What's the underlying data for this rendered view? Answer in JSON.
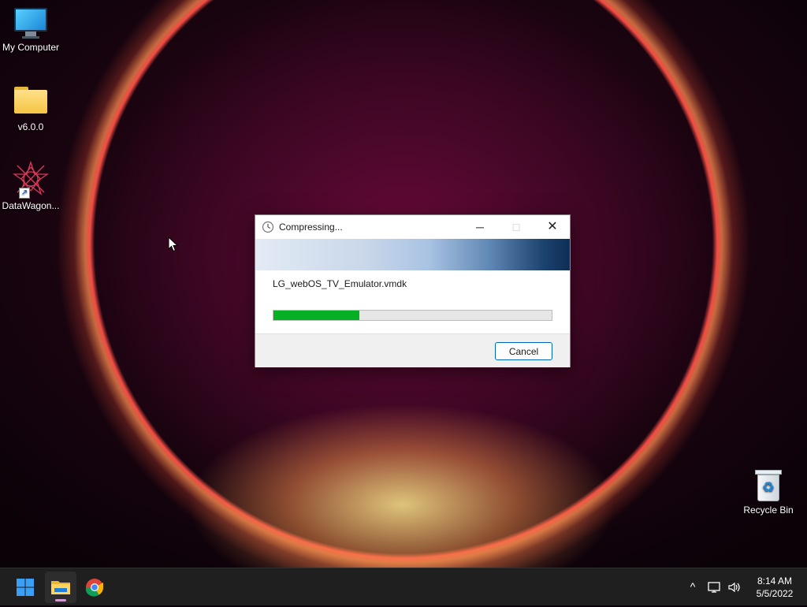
{
  "desktop": {
    "icons": [
      {
        "label": "My Computer",
        "icon": "monitor-icon"
      },
      {
        "label": "v6.0.0",
        "icon": "folder-icon"
      },
      {
        "label": "DataWagon...",
        "icon": "datawagon-app-icon"
      },
      {
        "label": "Recycle Bin",
        "icon": "recycle-bin-icon"
      }
    ]
  },
  "dialog": {
    "title": "Compressing...",
    "title_icon": "clock-icon",
    "controls": {
      "minimize": "─",
      "maximize": "□",
      "close": "✕"
    },
    "filename": "LG_webOS_TV_Emulator.vmdk",
    "progress": 0.31,
    "cancel_label": "Cancel"
  },
  "taskbar": {
    "items": [
      {
        "name": "start",
        "icon": "windows-start-icon"
      },
      {
        "name": "file-explorer",
        "icon": "folder-icon",
        "running": true
      },
      {
        "name": "chrome",
        "icon": "chrome-icon"
      }
    ],
    "tray": {
      "chevron": "^",
      "network_icon": "network-icon",
      "volume_icon": "speaker-icon"
    },
    "clock": {
      "time": "8:14 AM",
      "date": "5/5/2022"
    }
  },
  "colors": {
    "progress_fill": "#06b025",
    "accent": "#0067c0",
    "taskbar": "#1f1f1f"
  }
}
